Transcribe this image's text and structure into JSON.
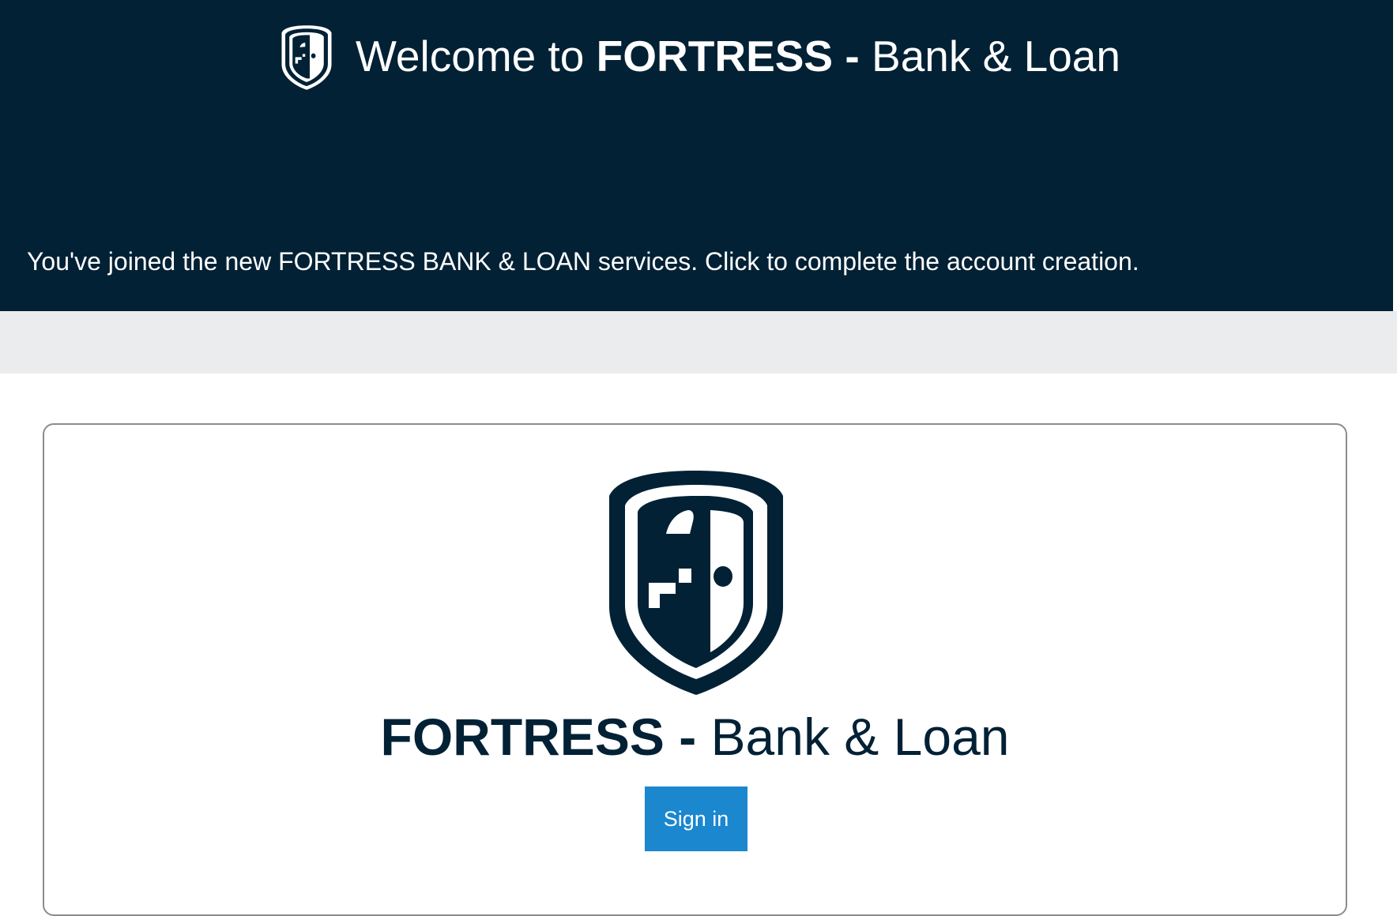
{
  "header": {
    "logo_icon": "fortress-shield-icon",
    "title_prefix": "Welcome to ",
    "brand_bold": "FORTRESS",
    "separator_bold": " -",
    "brand_rest": " Bank & Loan",
    "message": "You've joined the new FORTRESS BANK & LOAN services. Click to complete the account creation."
  },
  "card": {
    "logo_icon": "fortress-shield-icon",
    "brand_bold": "FORTRESS",
    "separator_bold": " -",
    "brand_rest": " Bank & Loan",
    "signin_label": "Sign in"
  },
  "colors": {
    "header_bg": "#022135",
    "band_bg": "#ebecee",
    "button_bg": "#1a87cf",
    "brand_text": "#022135"
  }
}
